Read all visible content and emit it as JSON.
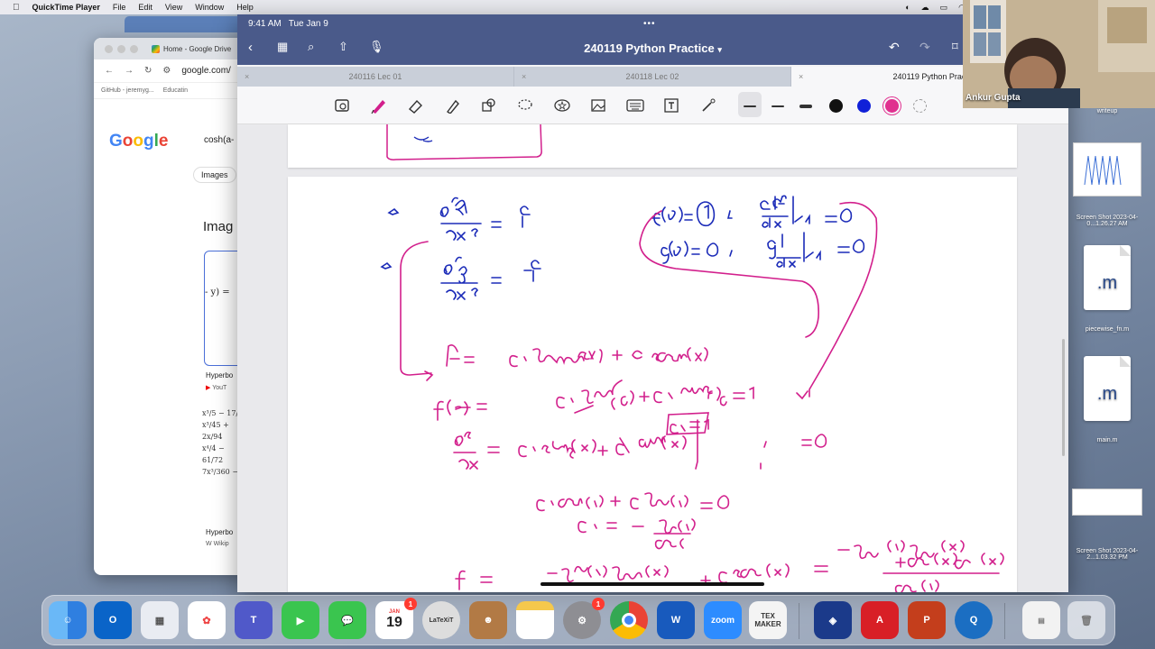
{
  "menubar": {
    "app_name": "QuickTime Player",
    "items": [
      "File",
      "Edit",
      "View",
      "Window",
      "Help"
    ]
  },
  "chrome": {
    "tab_title": "Home - Google Drive",
    "url": "google.com/",
    "bookmarks": [
      "GitHub - jeremyg...",
      "Educatin"
    ],
    "query": "cosh(a-",
    "images_label": "Images",
    "section_heading": "Imag",
    "card_math": "- y) =",
    "result1": "Hyperbo",
    "result1_source": "YouT",
    "math_lines": [
      "x³/5 − 17/3",
      "x³/45 + 2x/94",
      "x⁴/4 − 61/72",
      "7x³/360 − 1"
    ],
    "result2": "Hyperbo",
    "result2_source": "Wikip"
  },
  "goodnotes": {
    "time": "9:41 AM",
    "date": "Tue Jan 9",
    "title": "240119 Python Practice",
    "tabs": [
      {
        "label": "240116 Lec 01",
        "active": false
      },
      {
        "label": "240118 Lec 02",
        "active": false
      },
      {
        "label": "240119 Python Prac",
        "active": true
      }
    ],
    "ink_color": "#d21f8c",
    "ink_color_blue": "#1b2bb8"
  },
  "webcam": {
    "name": "Ankur Gupta"
  },
  "desktop": {
    "items": [
      {
        "label": "writeup",
        "type": "image"
      },
      {
        "label": "Screen Shot 2023-04-0...1.26.27 AM",
        "type": "image"
      },
      {
        "label": "piecewise_fn.m",
        "ext": ".m"
      },
      {
        "label": "main.m",
        "ext": ".m"
      },
      {
        "label": "Screen Shot 2023-04-2...1.03.32 PM",
        "type": "image"
      }
    ]
  },
  "dock": {
    "calendar_month": "JAN",
    "calendar_day": "19",
    "calendar_badge": "1",
    "settings_badge": "1",
    "zoom_label": "zoom",
    "texmaker_label": "TEX MAKER",
    "latexit_label": "LaTeXiT"
  }
}
